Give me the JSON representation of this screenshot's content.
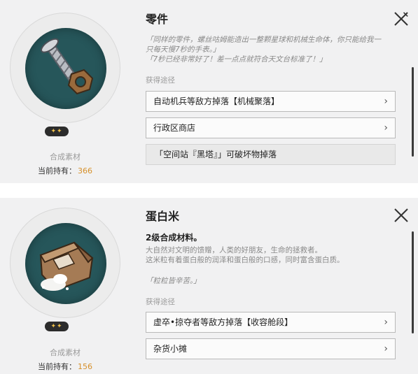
{
  "panels": [
    {
      "title": "零件",
      "stars": "✦✦",
      "material_label": "合成素材",
      "held_label": "当前持有：",
      "held_count": "366",
      "quote_lines": [
        "「同样的零件，螺丝咕姆能造出一整颗星球和机械生命体，你只能给我一",
        "只每天慢7秒的手表。」",
        "「7秒已经非常好了！差一点点就符合天文台标准了！」"
      ],
      "section_label": "获得途径",
      "sources": [
        {
          "label": "自动机兵等敌方掉落【机械聚落】",
          "chevron": "›"
        },
        {
          "label": "行政区商店",
          "chevron": "›"
        },
        {
          "label": "「空间站『黑塔』」可破坏物掉落",
          "chevron": ""
        }
      ]
    },
    {
      "title": "蛋白米",
      "stars": "✦✦",
      "material_label": "合成素材",
      "held_label": "当前持有：",
      "held_count": "156",
      "subtitle": "2级合成材料。",
      "desc_lines": [
        "大自然对文明的馈赠，人类的好朋友，生命的拯救者。",
        "这米粒有着蛋白般的润泽和蛋白般的口感，同时富含蛋白质。"
      ],
      "quote_lines": [
        "「粒粒皆辛苦。」"
      ],
      "section_label": "获得途径",
      "sources": [
        {
          "label": "虚卒•掠夺者等敌方掉落【收容舱段】",
          "chevron": "›"
        },
        {
          "label": "杂货小摊",
          "chevron": "›"
        }
      ]
    }
  ],
  "colors": {
    "disc": "#26565a",
    "accent_count": "#d6902a",
    "stars": "#f0c04a"
  }
}
